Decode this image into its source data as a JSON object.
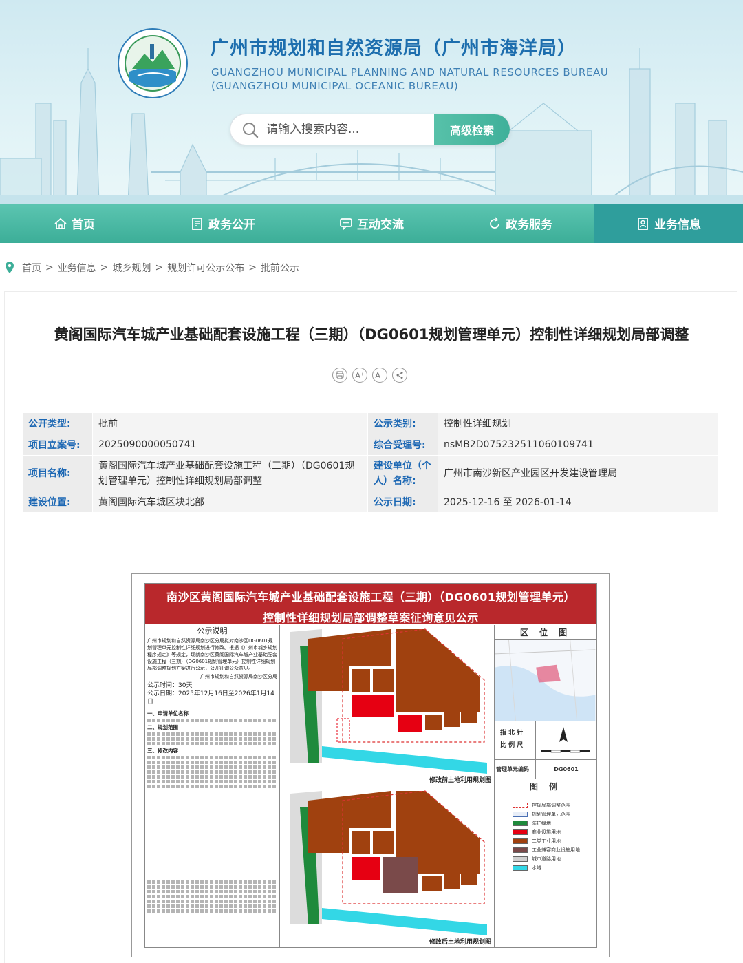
{
  "header": {
    "title_cn": "广州市规划和自然资源局（广州市海洋局）",
    "title_en_line1": "GUANGZHOU MUNICIPAL PLANNING AND NATURAL RESOURCES BUREAU",
    "title_en_line2": "(GUANGZHOU MUNICIPAL OCEANIC BUREAU)",
    "search_placeholder": "请输入搜索内容...",
    "advanced_search": "高级检索"
  },
  "nav": [
    {
      "label": "首页",
      "icon": "home-icon"
    },
    {
      "label": "政务公开",
      "icon": "document-icon"
    },
    {
      "label": "互动交流",
      "icon": "chat-icon"
    },
    {
      "label": "政务服务",
      "icon": "refresh-icon"
    },
    {
      "label": "业务信息",
      "icon": "user-card-icon"
    }
  ],
  "breadcrumb": [
    "首页",
    "业务信息",
    "城乡规划",
    "规划许可公示公布",
    "批前公示"
  ],
  "article": {
    "title": "黄阁国际汽车城产业基础配套设施工程（三期）（DG0601规划管理单元）控制性详细规划局部调整",
    "tools": [
      "print-icon",
      "font-larger-icon",
      "font-smaller-icon",
      "share-icon"
    ]
  },
  "info": {
    "type_label": "公开类型:",
    "type_value": "批前",
    "category_label": "公示类别:",
    "category_value": "控制性详细规划",
    "project_no_label": "项目立案号:",
    "project_no_value": "2025090000050741",
    "accept_no_label": "综合受理号:",
    "accept_no_value": "nsMB2D075232511060109741",
    "name_label": "项目名称:",
    "name_value": "黄阁国际汽车城产业基础配套设施工程（三期）（DG0601规划管理单元）控制性详细规划局部调整",
    "unit_label": "建设单位（个人）名称:",
    "unit_value": "广州市南沙新区产业园区开发建设管理局",
    "location_label": "建设位置:",
    "location_value": "黄阁国际汽车城区块北部",
    "date_label": "公示日期:",
    "date_value": "2025-12-16 至 2026-01-14"
  },
  "poster": {
    "head_line1": "南沙区黄阁国际汽车城产业基础配套设施工程（三期）（DG0601规划管理单元）",
    "head_line2": "控制性详细规划局部调整草案征询意见公示",
    "notice_title": "公示说明",
    "notice_body": "广州市规划和自然资源局南沙区分局拟对南沙区DG0601规划管理单元控制性详细规划进行修改。根据《广州市城乡规划程序规定》等规定，现就南沙区黄阁国际汽车城产业基础配套设施工程（三期）（DG0601规划管理单元）控制性详细规划局部调整规划方案进行公示，公开征询公众意见。",
    "notice_sign": "广州市规划和自然资源局南沙区分局",
    "period": "公示时间：30天",
    "dates": "公示日期：2025年12月16日至2026年1月14日",
    "sec1": "一、申请单位名称",
    "sec2": "二、规划范围",
    "sec3": "三、修改内容",
    "map_before_caption": "修改前土地利用规划图",
    "map_after_caption": "修改后土地利用规划图",
    "location_map_title": "区 位 图",
    "north_label": "指 北 针",
    "scale_label": "比 例 尺",
    "unit_code_label": "管理单元编码",
    "unit_code_value": "DG0601",
    "legend_title": "图 例",
    "legend": [
      {
        "label": "控规局部调整范围",
        "color": "#ffffff"
      },
      {
        "label": "规划管理单元范围",
        "color": "#e8eef8"
      },
      {
        "label": "防护绿地",
        "color": "#1f8a3c"
      },
      {
        "label": "商业设施用地",
        "color": "#e60012"
      },
      {
        "label": "二类工业用地",
        "color": "#a0410f"
      },
      {
        "label": "工业兼容商业设施用地",
        "color": "#7a4a4a"
      },
      {
        "label": "城市道路用地",
        "color": "#d0d0d0"
      },
      {
        "label": "水域",
        "color": "#33d7e6"
      }
    ]
  },
  "colors": {
    "nav": "#3cae98",
    "title_blue": "#1d6eae",
    "poster_red": "#b9282c"
  }
}
